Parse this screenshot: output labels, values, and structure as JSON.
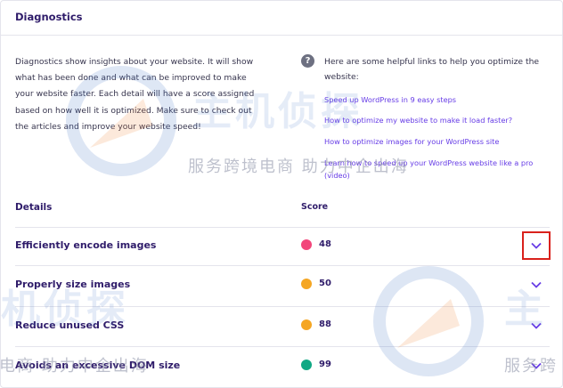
{
  "header": {
    "title": "Diagnostics"
  },
  "intro": {
    "text": "Diagnostics show insights about your website. It will show what has been done and what can be improved to make your website faster. Each detail will have a score assigned based on how well it is optimized. Make sure to check out the articles and improve your website speed!"
  },
  "help": {
    "intro": "Here are some helpful links to help you optimize the website:",
    "links": [
      "Speed up WordPress in 9 easy steps",
      "How to optimize my website to make it load faster?",
      "How to optimize images for your WordPress site",
      "Learn how to speed up your WordPress website like a pro (video)"
    ]
  },
  "table": {
    "details_label": "Details",
    "score_label": "Score",
    "rows": [
      {
        "title": "Efficiently encode images",
        "score": "48",
        "color": "#f2467b"
      },
      {
        "title": "Properly size images",
        "score": "50",
        "color": "#f5a623"
      },
      {
        "title": "Reduce unused CSS",
        "score": "88",
        "color": "#f5a623"
      },
      {
        "title": "Avoids an excessive DOM size",
        "score": "99",
        "color": "#11a884"
      }
    ]
  },
  "watermark": {
    "brand_top": "主机侦探",
    "line_top": "服务跨境电商 助力中企出海",
    "brand_mid": "机侦探",
    "line_bottom": "电商 助力中企出海",
    "brand_right": "主",
    "line_right": "服务跨"
  },
  "colors": {
    "accent": "#673de6",
    "highlight": "#d9211c",
    "text_dark": "#2f1c6a"
  },
  "icons": {
    "help": "question-circle-icon",
    "expand": "chevron-down-icon"
  }
}
